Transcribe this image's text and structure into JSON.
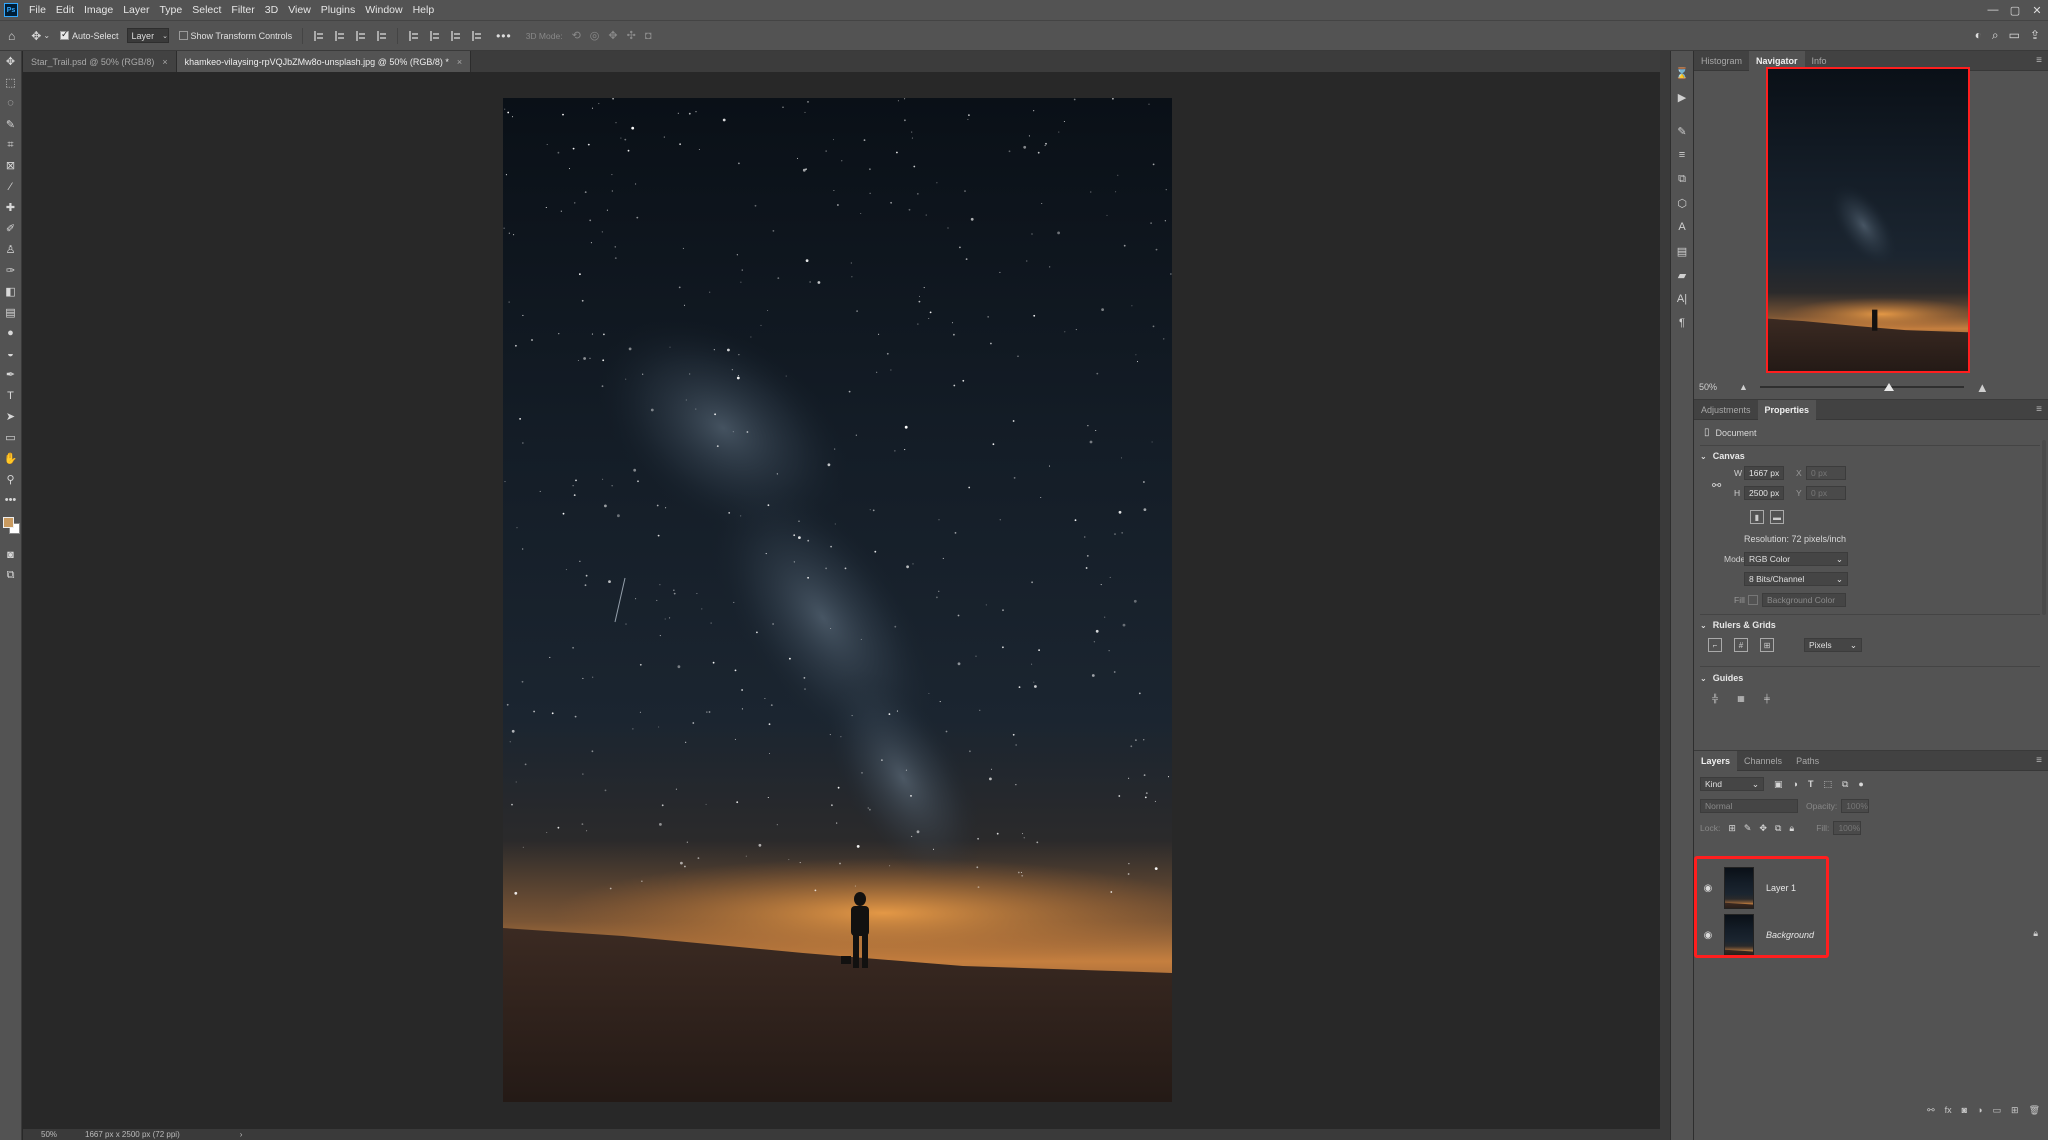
{
  "menubar": {
    "logo": "Ps",
    "items": [
      "File",
      "Edit",
      "Image",
      "Layer",
      "Type",
      "Select",
      "Filter",
      "3D",
      "View",
      "Plugins",
      "Window",
      "Help"
    ],
    "window_controls": [
      "—",
      "▢",
      "✕"
    ]
  },
  "options": {
    "auto_select_label": "Auto-Select",
    "auto_select_value": "Layer",
    "transform_label": "Show Transform Controls",
    "more": "•••",
    "mode_3d_label": "3D Mode:"
  },
  "tabs": [
    {
      "label": "Star_Trail.psd @ 50% (RGB/8)",
      "close": "×"
    },
    {
      "label": "khamkeo-vilaysing-rpVQJbZMw8o-unsplash.jpg @ 50% (RGB/8) *",
      "close": "×"
    }
  ],
  "status": {
    "zoom": "50%",
    "doc_info": "1667 px x 2500 px (72 ppi)",
    "arrow": "›"
  },
  "navigator_panel": {
    "tabs": [
      "Histogram",
      "Navigator",
      "Info"
    ],
    "active_tab": "Navigator",
    "zoom": "50%",
    "zoom_fraction": 0.5
  },
  "properties_panel": {
    "tabs": [
      "Adjustments",
      "Properties"
    ],
    "active_tab": "Properties",
    "doc_label": "Document",
    "canvas_section": "Canvas",
    "w_label": "W",
    "w_value": "1667 px",
    "h_label": "H",
    "h_value": "2500 px",
    "x_label": "X",
    "x_value": "0 px",
    "y_label": "Y",
    "y_value": "0 px",
    "resolution": "Resolution: 72 pixels/inch",
    "mode_label": "Mode",
    "mode_value": "RGB Color",
    "bits_value": "8 Bits/Channel",
    "fill_label": "Fill",
    "fill_value": "Background Color",
    "rulers_section": "Rulers & Grids",
    "units_value": "Pixels",
    "guides_section": "Guides"
  },
  "layers_panel": {
    "tabs": [
      "Layers",
      "Channels",
      "Paths"
    ],
    "active_tab": "Layers",
    "kind_label": "Kind",
    "blend_mode": "Normal",
    "opacity_label": "Opacity:",
    "opacity_value": "100%",
    "lock_label": "Lock:",
    "fill_label": "Fill:",
    "fill_value": "100%",
    "layers": [
      {
        "name": "Layer 1",
        "visible": true,
        "locked": false
      },
      {
        "name": "Background",
        "visible": true,
        "locked": true
      }
    ],
    "footer_icons": [
      "link-icon",
      "fx-icon",
      "mask-icon",
      "adjustment-icon",
      "group-icon",
      "new-layer-icon",
      "trash-icon"
    ]
  },
  "colors": {
    "highlight": "#ff1e1e",
    "foreground_swatch": "#c99a5f",
    "background_swatch": "#ffffff"
  }
}
